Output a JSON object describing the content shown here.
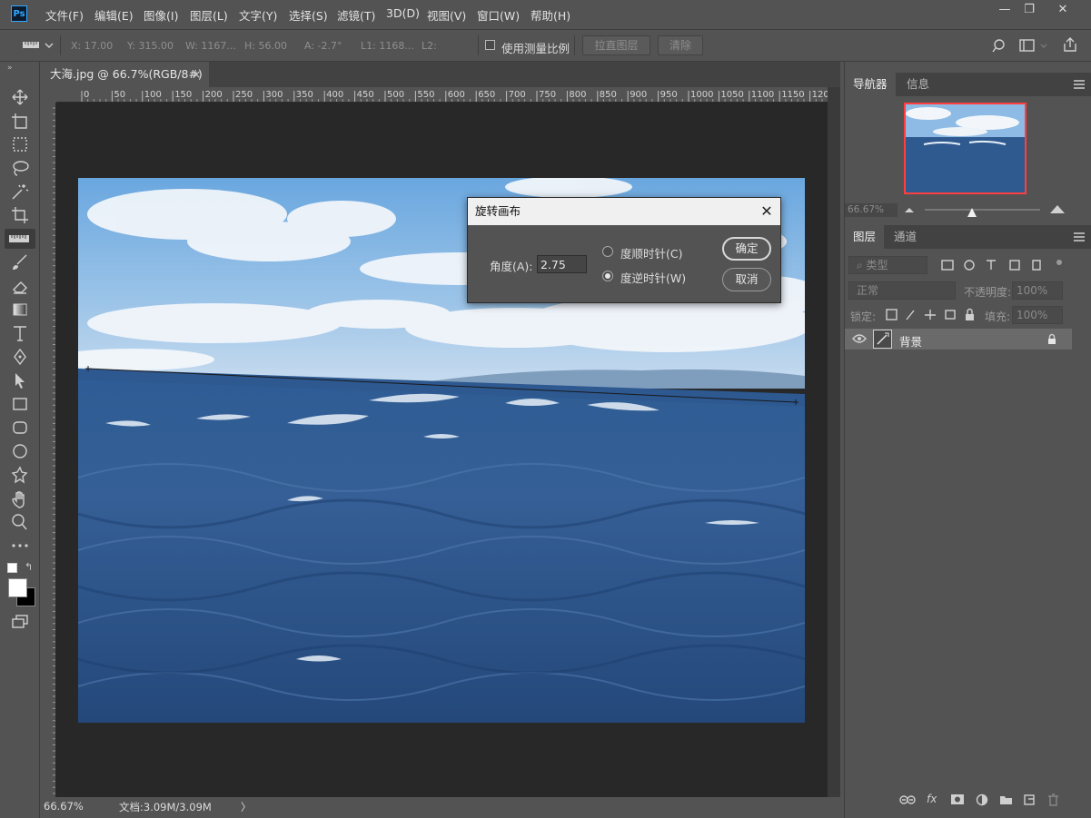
{
  "app": {
    "logo": "Ps"
  },
  "menu": [
    "文件(F)",
    "编辑(E)",
    "图像(I)",
    "图层(L)",
    "文字(Y)",
    "选择(S)",
    "滤镜(T)",
    "3D(D)",
    "视图(V)",
    "窗口(W)",
    "帮助(H)"
  ],
  "window_controls": {
    "minimize": "—",
    "restore": "❐",
    "close": "✕"
  },
  "options_bar": {
    "x": "X: 17.00",
    "y": "Y: 315.00",
    "w": "W: 1167...",
    "h": "H: 56.00",
    "a": "A: -2.7°",
    "l1": "L1: 1168...",
    "l2": "L2:",
    "use_scale_label": "使用测量比例",
    "straighten_button": "拉直图层",
    "clear_button": "清除"
  },
  "document": {
    "tab_title": "大海.jpg @ 66.7%(RGB/8#)",
    "tab_close": "×",
    "ruler_top": [
      "0",
      "50",
      "100",
      "150",
      "200",
      "250",
      "300",
      "350",
      "400",
      "450",
      "500",
      "550",
      "600",
      "650",
      "700",
      "750",
      "800",
      "850",
      "900",
      "950",
      "1000",
      "1050",
      "1100",
      "1150",
      "1200"
    ]
  },
  "status": {
    "zoom": "66.67%",
    "doc_info": "文档:3.09M/3.09M",
    "arrow": "〉"
  },
  "dialog": {
    "title": "旋转画布",
    "angle_label": "角度(A):",
    "angle_value": "2.75",
    "cw_label": "度顺时针(C)",
    "ccw_label": "度逆时针(W)",
    "selected": "ccw",
    "ok_button": "确定",
    "cancel_button": "取消"
  },
  "navigator": {
    "tabs": [
      "导航器",
      "信息"
    ],
    "zoom_value": "66.67%",
    "slider_fraction": 0.41
  },
  "layers": {
    "tabs": [
      "图层",
      "通道"
    ],
    "filter_kind": "类型",
    "blend_mode": "正常",
    "opacity_label": "不透明度:",
    "opacity_value": "100%",
    "lock_label": "锁定:",
    "fill_label": "填充:",
    "fill_value": "100%",
    "items": [
      {
        "name": "背景",
        "visible": true,
        "locked": true
      }
    ],
    "footer_fx": "fx"
  },
  "colors": {
    "accent_highlight": "#ff3f3f",
    "panel_bg": "#535353",
    "canvas_bg": "#282828"
  }
}
